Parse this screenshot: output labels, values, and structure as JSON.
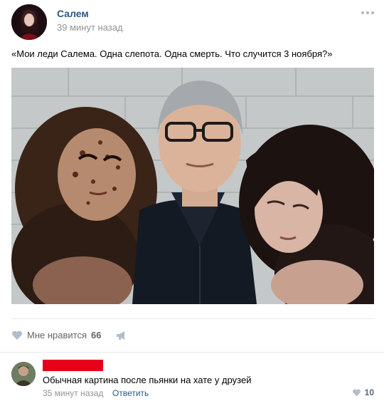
{
  "post": {
    "author": "Салем",
    "time": "39 минут назад",
    "text": "«Мои леди Салема. Одна слепота. Одна смерть. Что случится 3 ноября?»"
  },
  "actions": {
    "like_label": "Мне нравится",
    "like_count": "66"
  },
  "comment": {
    "text": "Обычная картина после пьянки на хате у друзей",
    "time": "35 минут назад",
    "reply_label": "Ответить",
    "like_count": "10"
  },
  "colors": {
    "link": "#2a5885",
    "muted": "#939393",
    "redaction": "#e8001a"
  }
}
